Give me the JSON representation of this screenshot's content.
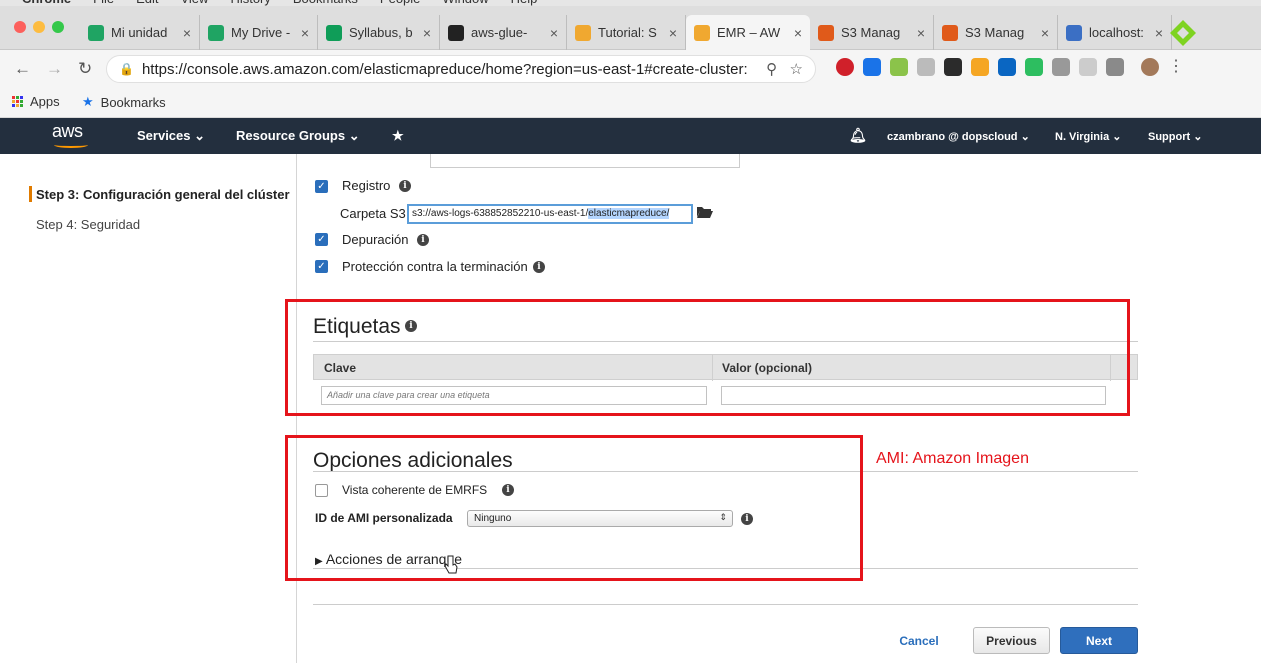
{
  "mac_menu": {
    "items": [
      "Chrome",
      "File",
      "Edit",
      "View",
      "History",
      "Bookmarks",
      "People",
      "Window",
      "Help"
    ]
  },
  "tabs": [
    {
      "label": "Mi unidad",
      "icon": "google-drive-icon",
      "color": "#1fa463"
    },
    {
      "label": "My Drive -",
      "icon": "google-drive-icon",
      "color": "#1fa463"
    },
    {
      "label": "Syllabus, b",
      "icon": "google-sheets-icon",
      "color": "#0f9d58"
    },
    {
      "label": "aws-glue-",
      "icon": "github-icon",
      "color": "#222222"
    },
    {
      "label": "Tutorial: S",
      "icon": "aws-cube-icon",
      "color": "#f0a830"
    },
    {
      "label": "EMR – AW",
      "icon": "aws-cube-icon",
      "color": "#f0a830",
      "active": true
    },
    {
      "label": "S3 Manag",
      "icon": "s3-bucket-icon",
      "color": "#e05a1a"
    },
    {
      "label": "S3 Manag",
      "icon": "s3-bucket-icon",
      "color": "#e05a1a"
    },
    {
      "label": "localhost:",
      "icon": "feather-icon",
      "color": "#3b6fc4"
    }
  ],
  "address": {
    "url": "https://console.aws.amazon.com/elasticmapreduce/home?region=us-east-1#create-cluster:"
  },
  "bookmarks": {
    "apps": "Apps",
    "bookmarks": "Bookmarks"
  },
  "aws_nav": {
    "logo": "aws",
    "services": "Services",
    "resource_groups": "Resource Groups",
    "user": "czambrano @ dopscloud",
    "region": "N. Virginia",
    "support": "Support"
  },
  "sidebar": {
    "steps": [
      {
        "label": "Step 3: Configuración general del clúster",
        "current": true
      },
      {
        "label": "Step 4: Seguridad",
        "current": false
      }
    ]
  },
  "general": {
    "registro_label": "Registro",
    "registro_checked": true,
    "carpeta_label": "Carpeta S3",
    "carpeta_prefix": "s3://aws-logs-638852852210-us-east-1/",
    "carpeta_selected": "elasticmapreduce/",
    "depuracion_label": "Depuración",
    "depuracion_checked": true,
    "proteccion_label": "Protección contra la terminación",
    "proteccion_checked": true
  },
  "etiquetas": {
    "title": "Etiquetas",
    "col_clave": "Clave",
    "col_valor": "Valor (opcional)",
    "clave_placeholder": "Añadir una clave para crear una etiqueta",
    "valor_value": ""
  },
  "opciones": {
    "title": "Opciones adicionales",
    "emrfs_label": "Vista coherente de EMRFS",
    "emrfs_checked": false,
    "ami_label": "ID de AMI personalizada",
    "ami_value": "Ninguno",
    "acciones_label": "Acciones de arranque"
  },
  "footer": {
    "cancel": "Cancel",
    "previous": "Previous",
    "next": "Next"
  },
  "annotation": {
    "text": "AMI: Amazon Imagen",
    "color": "#e5141b"
  },
  "colors": {
    "aws_nav_bg": "#232f3e",
    "aws_orange": "#ff9900",
    "primary_blue": "#2f6fbd"
  }
}
